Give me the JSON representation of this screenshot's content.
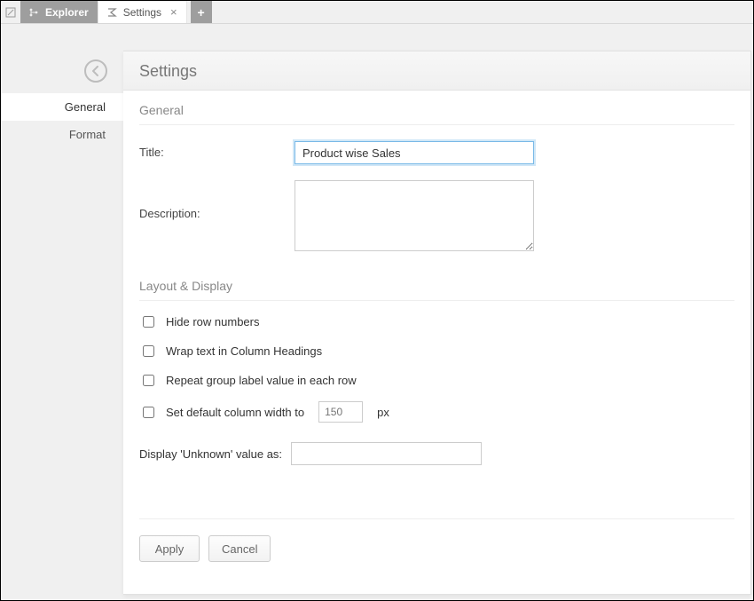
{
  "tabs": {
    "explorer": {
      "label": "Explorer"
    },
    "settings": {
      "label": "Settings"
    }
  },
  "sidebar": {
    "items": [
      {
        "label": "General"
      },
      {
        "label": "Format"
      }
    ]
  },
  "panel": {
    "title": "Settings",
    "sections": {
      "general": {
        "heading": "General",
        "title_label": "Title:",
        "title_value": "Product wise Sales",
        "description_label": "Description:",
        "description_value": ""
      },
      "layout": {
        "heading": "Layout & Display",
        "hide_row_numbers": "Hide row numbers",
        "wrap_text": "Wrap text in Column Headings",
        "repeat_group": "Repeat group label value in each row",
        "default_width_prefix": "Set default column width to",
        "default_width_value": "150",
        "default_width_suffix": "px",
        "unknown_label": "Display 'Unknown' value as:",
        "unknown_value": ""
      }
    },
    "buttons": {
      "apply": "Apply",
      "cancel": "Cancel"
    }
  }
}
